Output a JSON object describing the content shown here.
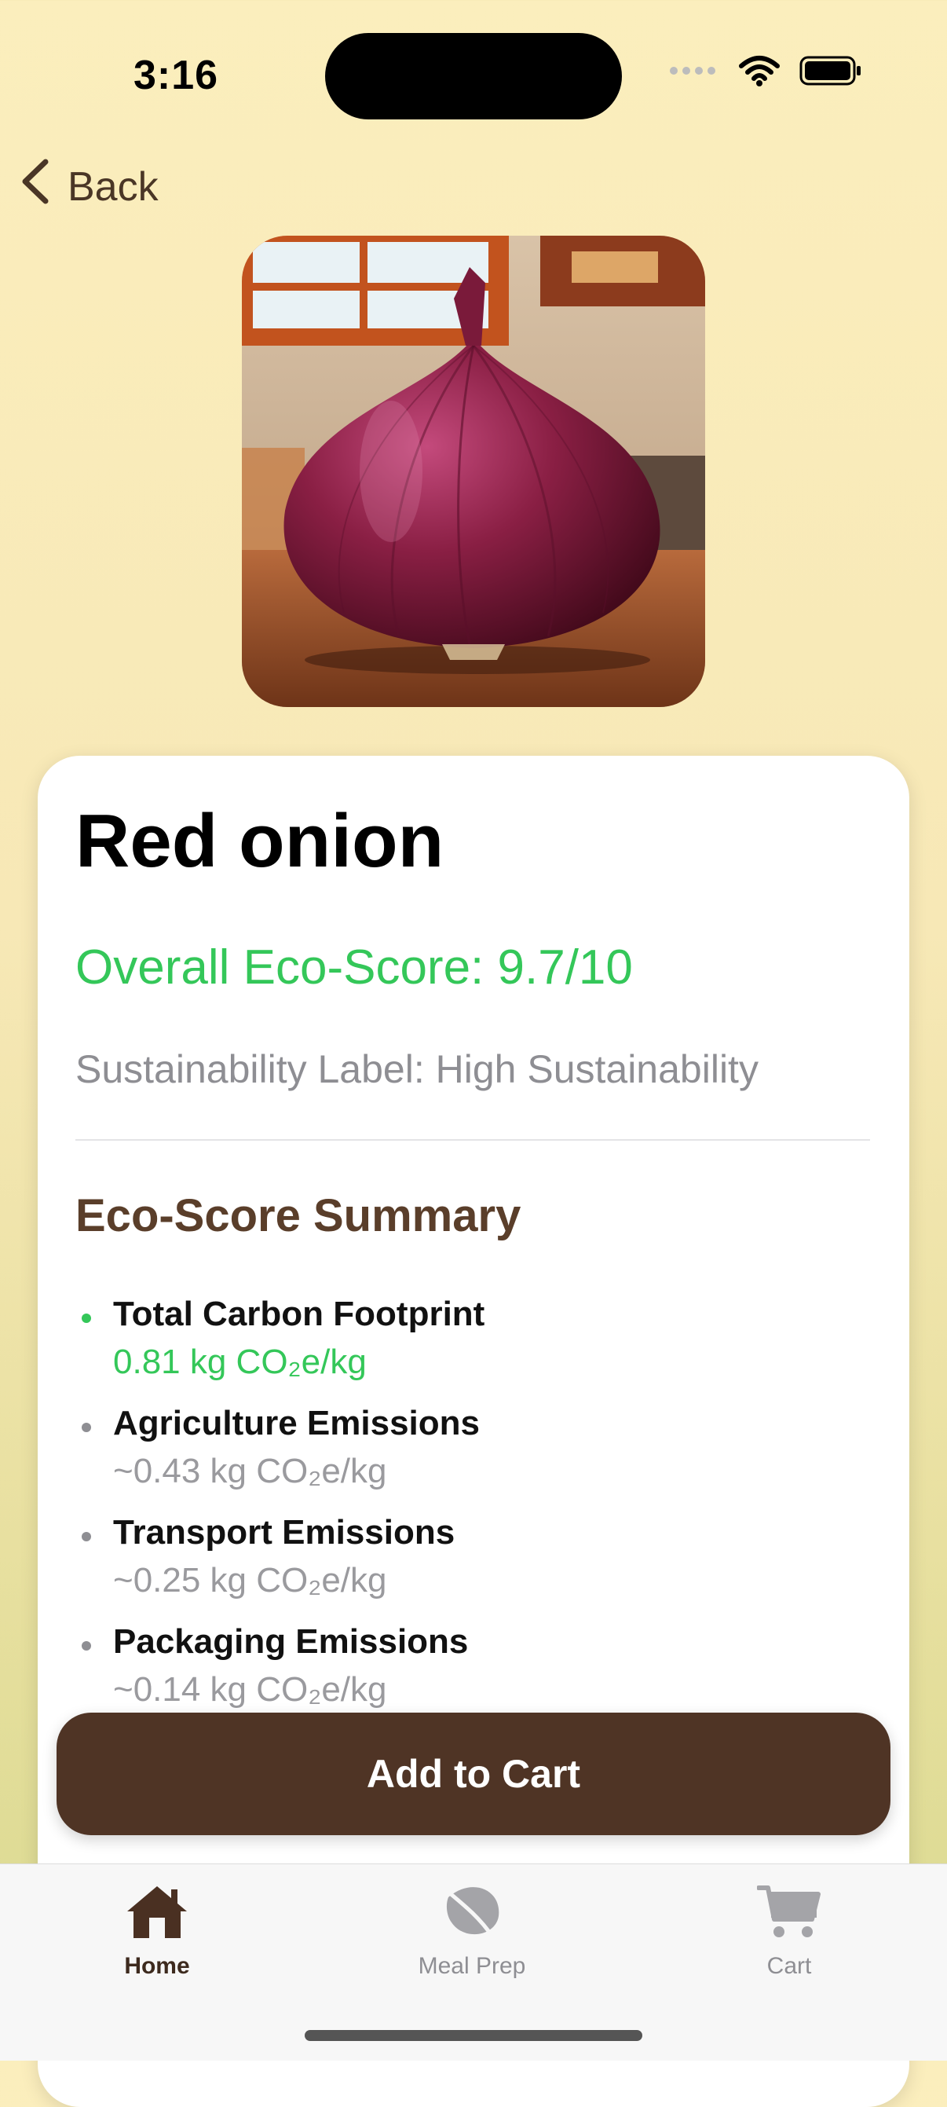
{
  "status_bar": {
    "time": "3:16"
  },
  "nav": {
    "back_label": "Back"
  },
  "product": {
    "name": "Red onion",
    "eco_score": "Overall Eco-Score: 9.7/10",
    "sustainability_label": "Sustainability Label: High Sustainability",
    "image_icon": "red-onion-photo"
  },
  "summary": {
    "title": "Eco-Score Summary",
    "items": [
      {
        "label": "Total Carbon Footprint",
        "value": "0.81 kg CO₂e/kg"
      },
      {
        "label": "Agriculture Emissions",
        "value": "~0.43 kg CO₂e/kg"
      },
      {
        "label": "Transport Emissions",
        "value": "~0.25 kg CO₂e/kg"
      },
      {
        "label": "Packaging Emissions",
        "value": "~0.14 kg CO₂e/kg"
      }
    ]
  },
  "actions": {
    "add_to_cart_label": "Add to Cart"
  },
  "tab_bar": {
    "tabs": [
      {
        "label": "Home",
        "icon": "house-icon",
        "active": true
      },
      {
        "label": "Meal Prep",
        "icon": "leaf-icon",
        "active": false
      },
      {
        "label": "Cart",
        "icon": "cart-icon",
        "active": false
      }
    ]
  },
  "colors": {
    "accent_green": "#34c759",
    "brand_brown": "#4f3425",
    "background": "#fbeebd"
  }
}
